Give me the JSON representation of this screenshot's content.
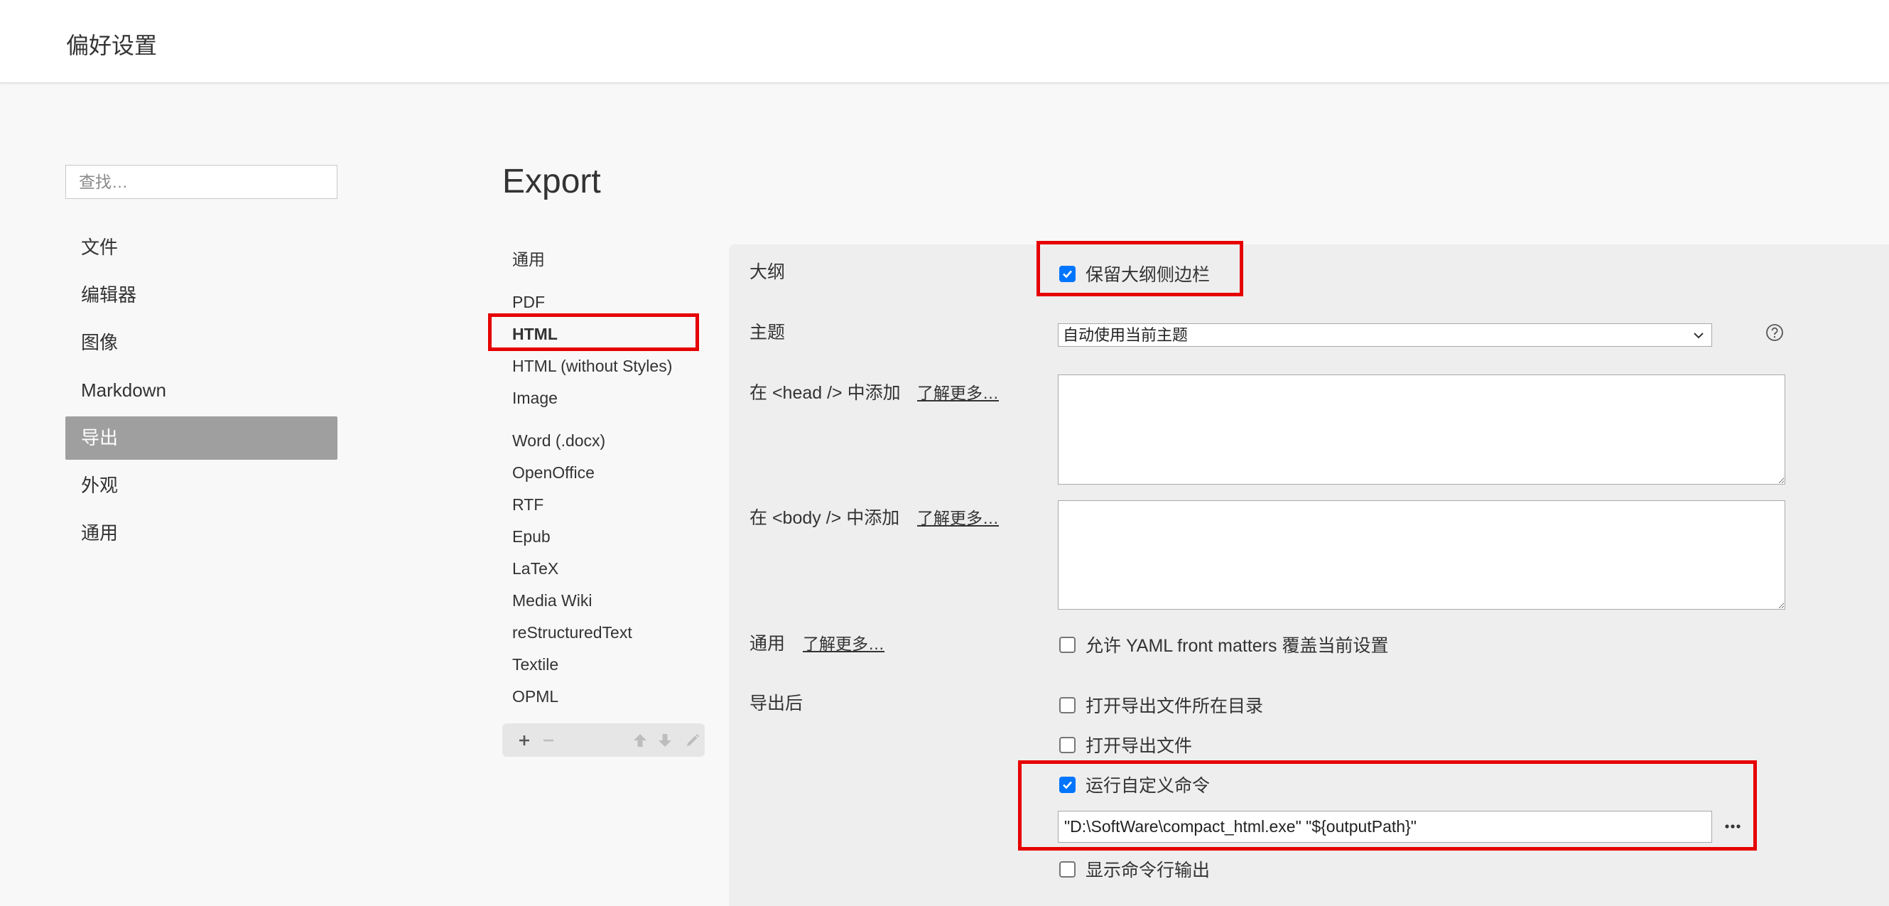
{
  "header": {
    "title": "偏好设置"
  },
  "search": {
    "placeholder": "查找…"
  },
  "sidebar": {
    "items": [
      {
        "label": "文件"
      },
      {
        "label": "编辑器"
      },
      {
        "label": "图像"
      },
      {
        "label": "Markdown"
      },
      {
        "label": "导出",
        "selected": true
      },
      {
        "label": "外观"
      },
      {
        "label": "通用"
      }
    ]
  },
  "export": {
    "heading": "Export",
    "format_groups": [
      [
        {
          "label": "通用"
        }
      ],
      [
        {
          "label": "PDF"
        },
        {
          "label": "HTML",
          "selected": true
        },
        {
          "label": "HTML (without Styles)"
        },
        {
          "label": "Image"
        }
      ],
      [
        {
          "label": "Word (.docx)"
        },
        {
          "label": "OpenOffice"
        },
        {
          "label": "RTF"
        },
        {
          "label": "Epub"
        },
        {
          "label": "LaTeX"
        },
        {
          "label": "Media Wiki"
        },
        {
          "label": "reStructuredText"
        },
        {
          "label": "Textile"
        },
        {
          "label": "OPML"
        }
      ]
    ],
    "toolbar_icons": [
      "plus-icon",
      "minus-icon",
      "arrow-up-icon",
      "arrow-down-icon",
      "pencil-icon"
    ]
  },
  "settings": {
    "outline": {
      "label": "大纲",
      "option": {
        "label": "保留大纲侧边栏",
        "checked": true
      }
    },
    "theme": {
      "label": "主题",
      "value": "自动使用当前主题"
    },
    "head": {
      "label": "在 <head /> 中添加",
      "link": "了解更多…"
    },
    "body": {
      "label": "在 <body /> 中添加",
      "link": "了解更多…"
    },
    "general": {
      "label": "通用",
      "link": "了解更多…",
      "option": {
        "label": "允许 YAML front matters 覆盖当前设置",
        "checked": false
      }
    },
    "after_export": {
      "label": "导出后",
      "options": [
        {
          "label": "打开导出文件所在目录",
          "checked": false
        },
        {
          "label": "打开导出文件",
          "checked": false
        },
        {
          "label": "运行自定义命令",
          "checked": true
        }
      ],
      "command": "\"D:\\SoftWare\\compact_html.exe\" \"${outputPath}\"",
      "show_output": {
        "label": "显示命令行输出",
        "checked": false
      }
    }
  },
  "colors": {
    "accent": "#0075ff",
    "highlight": "#e60000",
    "selected_bg": "#9f9f9f"
  }
}
